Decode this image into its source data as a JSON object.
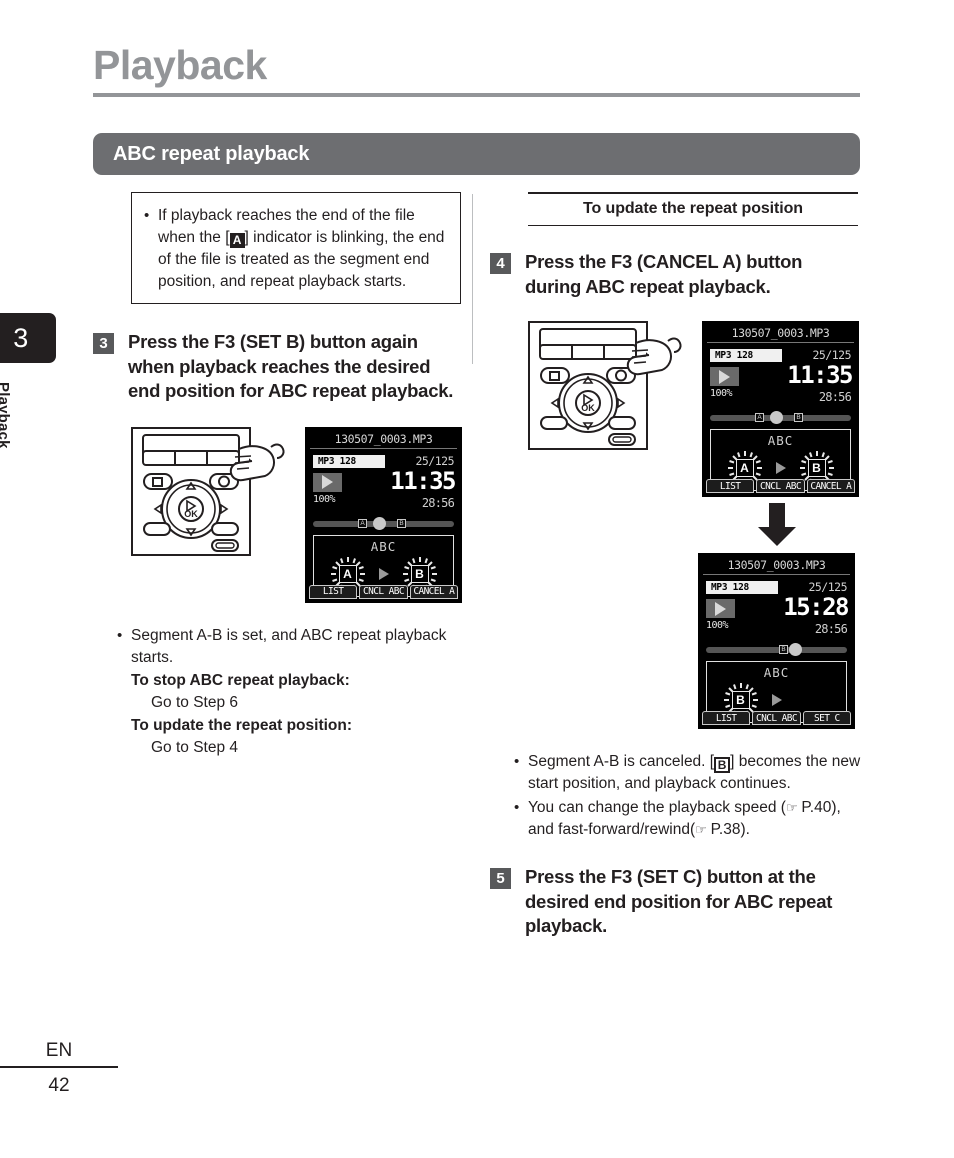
{
  "page": {
    "title": "Playback",
    "section_banner": "ABC repeat playback",
    "chapter_number": "3",
    "chapter_label": "Playback",
    "language": "EN",
    "page_number": "42"
  },
  "left_column": {
    "note": {
      "bullet": "•",
      "text_part1": "If playback reaches the end of the file when the [",
      "indicator": "A",
      "text_part2": "] indicator is blinking, the end of the file is treated as the segment end position, and repeat playback starts."
    },
    "step3": {
      "number": "3",
      "text": "Press the F3 (SET B) button again when playback reaches the desired end position for ABC repeat playback."
    },
    "lcd": {
      "filename": "130507_0003.MP3",
      "codec": "MP3 128",
      "file_index": "25/125",
      "elapsed": "11:35",
      "total": "28:56",
      "speed": "100%",
      "abc_label": "ABC",
      "marker_a": "A",
      "marker_b": "B",
      "progress_a_label": "A",
      "progress_b_label": "B",
      "softkeys": [
        "LIST",
        "CNCL ABC",
        "CANCEL A"
      ]
    },
    "result": {
      "bullet": "•",
      "text": "Segment A-B is set, and ABC repeat playback starts.",
      "stop_heading": "To stop ABC repeat playback:",
      "stop_value": "Go to Step 6",
      "update_heading": "To update the repeat position:",
      "update_value": "Go to Step 4"
    }
  },
  "right_column": {
    "sub_heading": "To update the repeat position",
    "step4": {
      "number": "4",
      "text": "Press the F3 (CANCEL A) button during ABC repeat playback."
    },
    "lcd_before": {
      "filename": "130507_0003.MP3",
      "codec": "MP3 128",
      "file_index": "25/125",
      "elapsed": "11:35",
      "total": "28:56",
      "speed": "100%",
      "abc_label": "ABC",
      "marker_a": "A",
      "marker_b": "B",
      "progress_a_label": "A",
      "progress_b_label": "B",
      "softkeys": [
        "LIST",
        "CNCL ABC",
        "CANCEL A"
      ]
    },
    "lcd_after": {
      "filename": "130507_0003.MP3",
      "codec": "MP3 128",
      "file_index": "25/125",
      "elapsed": "15:28",
      "total": "28:56",
      "speed": "100%",
      "abc_label": "ABC",
      "marker_b": "B",
      "progress_b_label": "B",
      "softkeys": [
        "LIST",
        "CNCL ABC",
        "SET C"
      ]
    },
    "notes": {
      "bullet1_part1": "Segment A-B is canceled. [",
      "bullet1_indicator": "B",
      "bullet1_part2": "] becomes the new start position, and playback continues.",
      "bullet2_part1": "You can change the playback speed (",
      "bullet2_ref1": "P.40",
      "bullet2_part2": "), and fast-forward/rewind(",
      "bullet2_ref2": "P.38",
      "bullet2_part3": ")."
    },
    "step5": {
      "number": "5",
      "text": "Press the F3 (SET C) button at the desired end position for ABC repeat playback."
    }
  },
  "icons": {
    "ref_arrow": "☞",
    "bullet": "•",
    "down_arrow": "down-arrow"
  },
  "colors": {
    "header_gray": "#939598",
    "banner_gray": "#6d6e71",
    "step_badge": "#58595b",
    "text": "#231f20"
  }
}
